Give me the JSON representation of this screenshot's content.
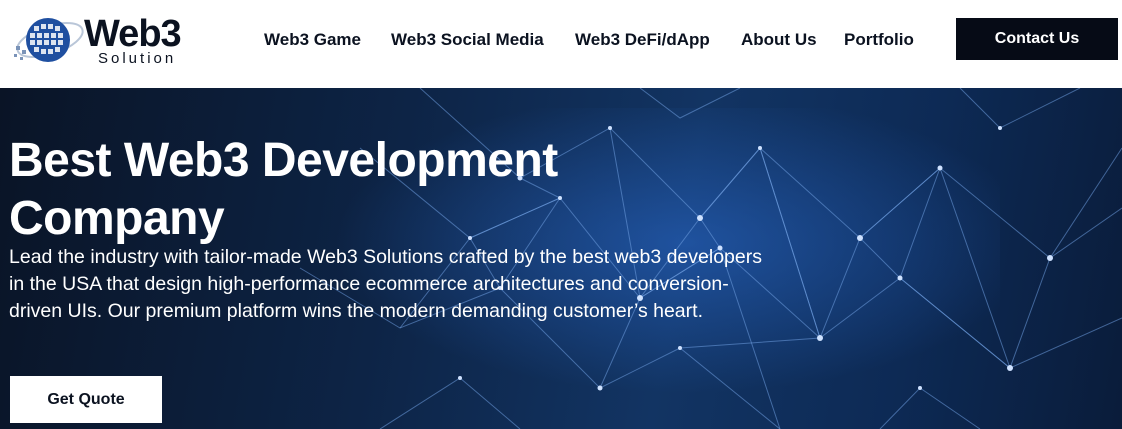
{
  "header": {
    "logo": {
      "word": "Web3",
      "sub": "Solution"
    },
    "nav": [
      {
        "label": "Web3 Game"
      },
      {
        "label": "Web3 Social Media"
      },
      {
        "label": "Web3 DeFi/dApp"
      },
      {
        "label": "About Us"
      },
      {
        "label": "Portfolio"
      }
    ],
    "contact_label": "Contact Us"
  },
  "hero": {
    "title": "Best Web3 Development Company",
    "description": "Lead the industry with tailor-made Web3 Solutions crafted by the best web3 developers in the USA that design high-performance ecommerce architectures and conversion-driven UIs. Our premium platform wins the modern demanding customer’s heart.",
    "cta_label": "Get Quote"
  },
  "colors": {
    "dark": "#060b16",
    "hero_blue": "#123463",
    "accent": "#1f4fa0"
  }
}
